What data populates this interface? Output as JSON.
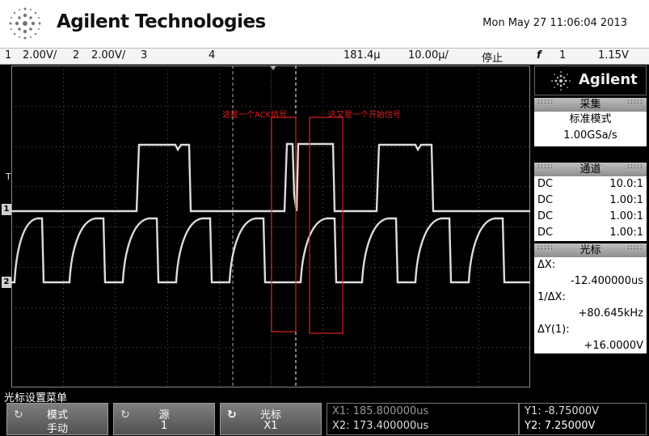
{
  "header": {
    "brand": "Agilent Technologies",
    "datetime": "Mon May 27 11:06:04 2013"
  },
  "status": {
    "ch1_num": "1",
    "ch1_scale": "2.00V/",
    "ch2_num": "2",
    "ch2_scale": "2.00V/",
    "ch3_num": "3",
    "ch4_num": "4",
    "time_delay": "181.4µ",
    "time_scale": "10.00µ/",
    "run_state": "停止",
    "trig_icon": "f",
    "trig_src": "1",
    "trig_level": "1.15V"
  },
  "annotations": {
    "ack": "这是一个ACK信号",
    "start": "这又是一个开始信号"
  },
  "markers": {
    "trigger": "T",
    "ch1": "1",
    "ch2": "2"
  },
  "sidebar": {
    "logo_text": "Agilent",
    "acq_title": "采集",
    "acq_mode": "标准模式",
    "acq_rate": "1.00GSa/s",
    "chan_title": "通道",
    "channels": [
      {
        "coupling": "DC",
        "probe": "10.0:1"
      },
      {
        "coupling": "DC",
        "probe": "1.00:1"
      },
      {
        "coupling": "DC",
        "probe": "1.00:1"
      },
      {
        "coupling": "DC",
        "probe": "1.00:1"
      }
    ],
    "cursor_title": "光标",
    "dx_label": "ΔX:",
    "dx_value": "-12.400000us",
    "inv_dx_label": "1/ΔX:",
    "inv_dx_value": "+80.645kHz",
    "dy_label": "ΔY(1):",
    "dy_value": "+16.0000V"
  },
  "menu": {
    "title": "光标设置菜单"
  },
  "softkeys": [
    {
      "label": "模式",
      "value": "手动"
    },
    {
      "label": "源",
      "value": "1"
    },
    {
      "label": "光标",
      "value": "X1"
    }
  ],
  "cursor_readout": {
    "x1": "X1: 185.800000us",
    "x2": "X2: 173.400000us",
    "y1": "Y1: -8.75000V",
    "y2": "Y2: 7.25000V"
  },
  "colors": {
    "trace": "#dcdcdc",
    "annotation": "#e02020",
    "grid": "#555555",
    "cursor_x1": "#cfcfcf",
    "cursor_y2": "#ffffff"
  }
}
